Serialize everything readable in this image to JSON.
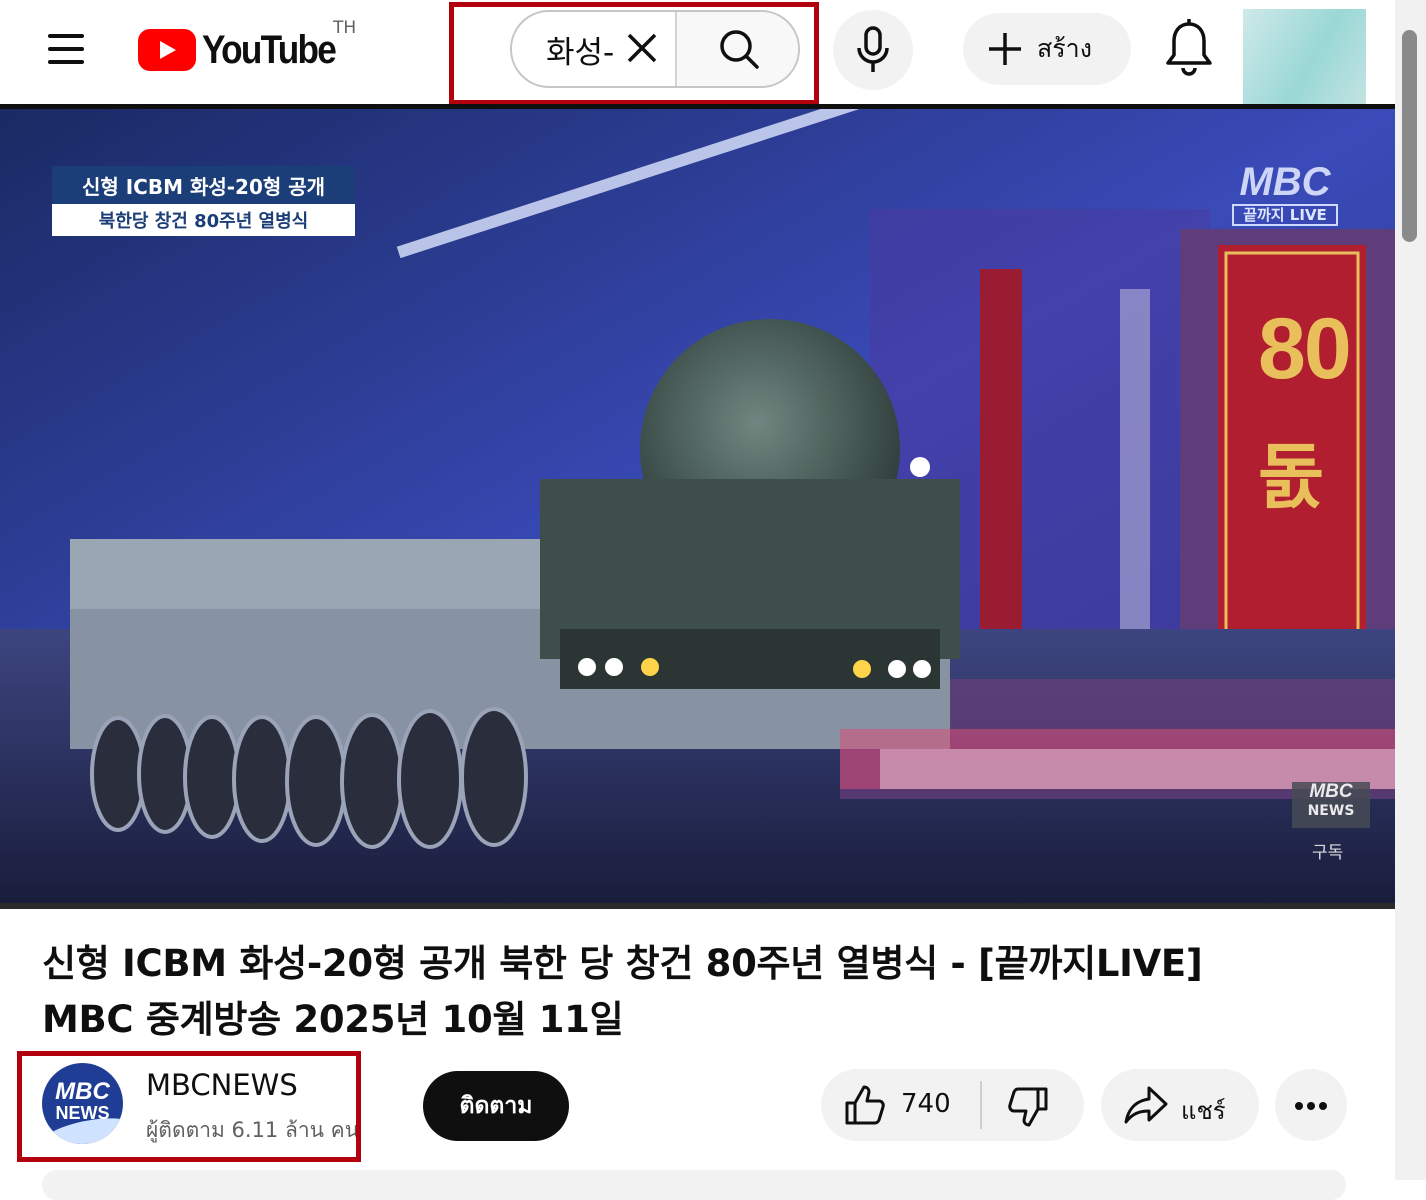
{
  "header": {
    "logo_text": "YouTube",
    "country_code": "TH",
    "search": {
      "value": "화성-",
      "placeholder": ""
    },
    "create_label": "สร้าง"
  },
  "video": {
    "overlay": {
      "caption_line1": "신형 ICBM 화성-20형 공개",
      "caption_line2": "북한당 창건 80주년 열병식",
      "broadcaster_logo": "MBC",
      "broadcaster_program": "끝까지 LIVE",
      "banner_number": "80",
      "banner_text": "돐",
      "watermark_line1": "MBC",
      "watermark_line2": "NEWS",
      "watermark_sub": "구독"
    },
    "title_line1": "신형 ICBM 화성-20형 공개 북한 당 창건 80주년 열병식 - [끝까지LIVE]",
    "title_line2": "MBC 중계방송 2025년 10월 11일"
  },
  "channel": {
    "avatar_line1": "MBC",
    "avatar_line2": "NEWS",
    "name": "MBCNEWS",
    "subscribers": "ผู้ติดตาม 6.11 ล้าน คน",
    "subscribe_label": "ติดตาม"
  },
  "actions": {
    "like_count": "740",
    "share_label": "แชร์"
  },
  "colors": {
    "brand_red": "#ff0000",
    "highlight_box": "#b3000f",
    "subscribe_bg": "#0f0f0f",
    "chip_bg": "#f2f2f2"
  },
  "icons": [
    "menu-icon",
    "youtube-logo-icon",
    "close-icon",
    "search-icon",
    "mic-icon",
    "plus-icon",
    "bell-icon",
    "thumbs-up-icon",
    "thumbs-down-icon",
    "share-arrow-icon",
    "more-dots-icon"
  ]
}
